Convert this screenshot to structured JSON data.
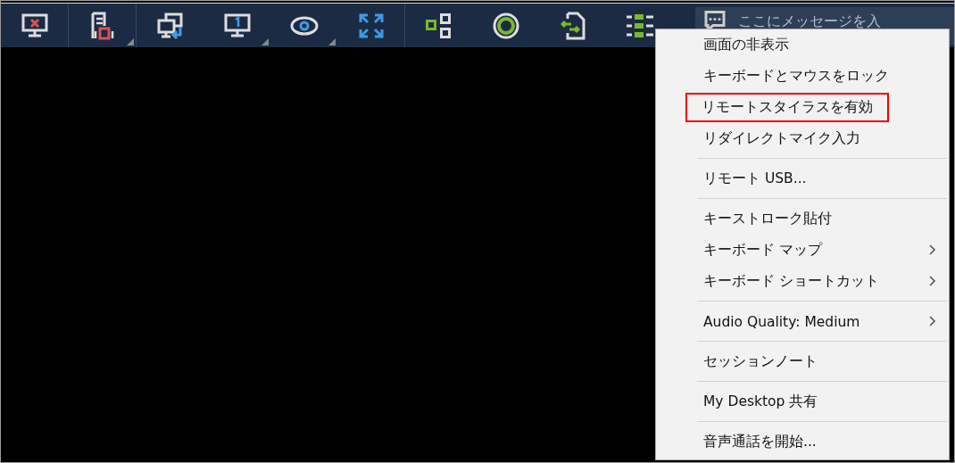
{
  "toolbar": {
    "buttons": [
      {
        "dropdown": false,
        "divider_after": true
      },
      {
        "dropdown": true,
        "divider_after": true
      },
      {
        "dropdown": false,
        "divider_after": false
      },
      {
        "dropdown": true,
        "divider_after": false
      },
      {
        "dropdown": true,
        "divider_after": false
      },
      {
        "dropdown": false,
        "divider_after": true
      },
      {
        "dropdown": false,
        "divider_after": false
      },
      {
        "dropdown": false,
        "divider_after": false
      },
      {
        "dropdown": false,
        "divider_after": false
      },
      {
        "divider_after": false
      }
    ],
    "message_field": {
      "placeholder": "ここにメッセージを入"
    }
  },
  "menu": {
    "items": [
      {
        "label": "画面の非表示",
        "separator_before": false,
        "submenu": false,
        "highlighted": false
      },
      {
        "label": "キーボードとマウスをロック",
        "separator_before": false,
        "submenu": false,
        "highlighted": false
      },
      {
        "label": "リモートスタイラスを有効",
        "separator_before": false,
        "submenu": false,
        "highlighted": true
      },
      {
        "label": "リダイレクトマイク入力",
        "separator_before": false,
        "submenu": false,
        "highlighted": false
      },
      {
        "label": "リモート USB...",
        "separator_before": true,
        "submenu": false,
        "highlighted": false
      },
      {
        "label": "キーストローク貼付",
        "separator_before": true,
        "submenu": false,
        "highlighted": false
      },
      {
        "label": "キーボード マップ",
        "separator_before": false,
        "submenu": true,
        "highlighted": false
      },
      {
        "label": "キーボード ショートカット",
        "separator_before": false,
        "submenu": true,
        "highlighted": false
      },
      {
        "label": "Audio Quality: Medium",
        "separator_before": true,
        "submenu": true,
        "highlighted": false
      },
      {
        "label": "セッションノート",
        "separator_before": true,
        "submenu": false,
        "highlighted": false
      },
      {
        "label": "My Desktop 共有",
        "separator_before": true,
        "submenu": false,
        "highlighted": false
      },
      {
        "label": "音声通話を開始...",
        "separator_before": true,
        "submenu": false,
        "highlighted": false
      }
    ]
  }
}
